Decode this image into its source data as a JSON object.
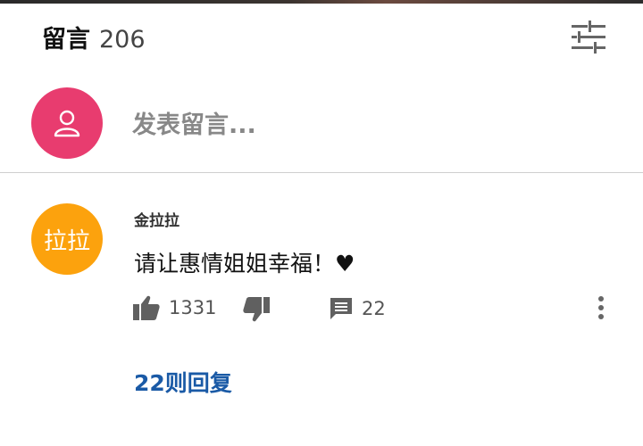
{
  "header": {
    "title": "留言",
    "count": "206",
    "filter_icon": "sliders-icon"
  },
  "compose": {
    "avatar_icon": "user-icon",
    "avatar_color": "#e83c6f",
    "placeholder": "发表留言..."
  },
  "comment": {
    "avatar_text": "拉拉",
    "avatar_color": "#fca20d",
    "author": "金拉拉",
    "text": "请让惠情姐姐幸福！♥",
    "likes": "1331",
    "replies_count": "22",
    "replies_link": "22则回复",
    "link_color": "#1a5aa6"
  }
}
